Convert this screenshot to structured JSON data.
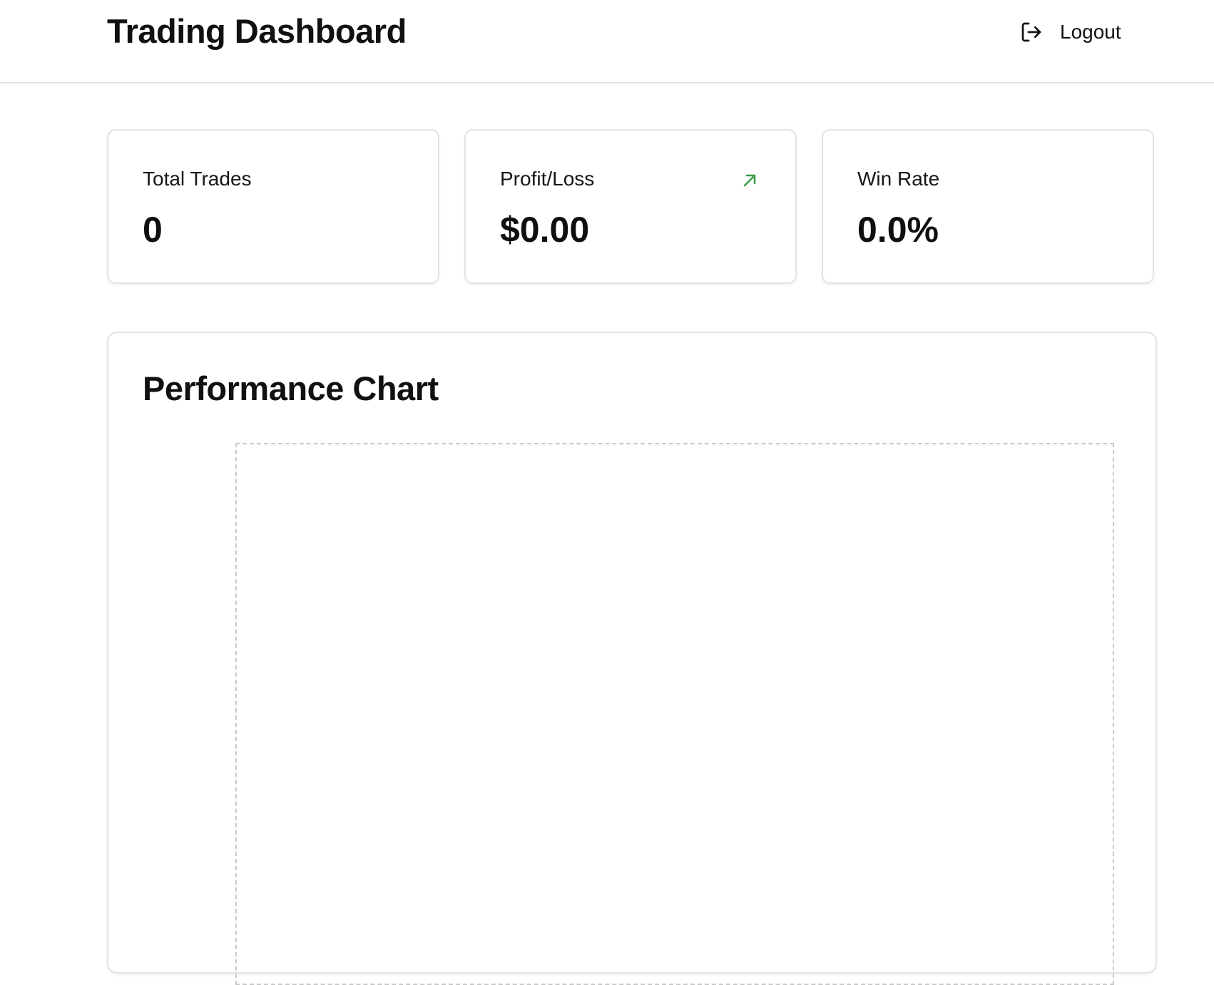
{
  "header": {
    "title": "Trading Dashboard",
    "logout_label": "Logout",
    "logout_icon": "logout-icon"
  },
  "stats": [
    {
      "label": "Total Trades",
      "value": "0"
    },
    {
      "label": "Profit/Loss",
      "value": "$0.00",
      "trend_icon": "arrow-up-right-icon",
      "trend_color": "#3a9a4a"
    },
    {
      "label": "Win Rate",
      "value": "0.0%"
    }
  ],
  "chart": {
    "title": "Performance Chart"
  },
  "colors": {
    "border": "#e3e3e3",
    "text": "#111111",
    "positive": "#3a9a4a",
    "plot_border": "#c9c9c9"
  }
}
